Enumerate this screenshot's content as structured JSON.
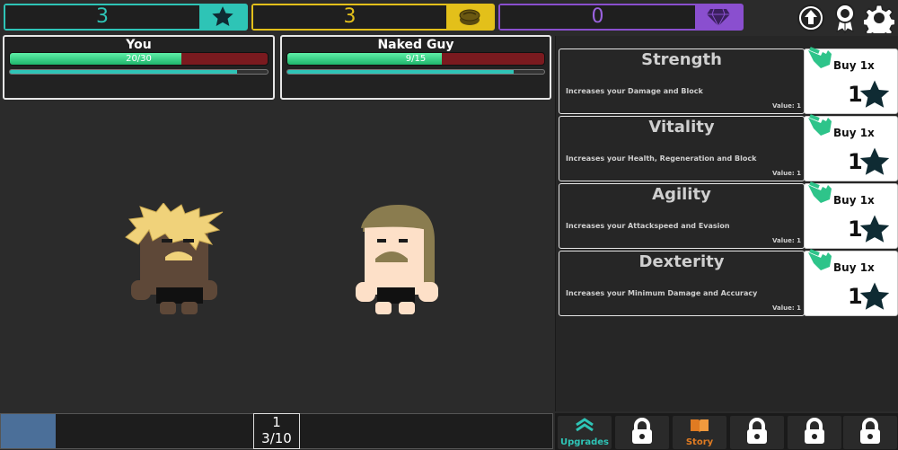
{
  "currencies": {
    "stars": {
      "value": "3",
      "icon": "star-icon",
      "color": "#2ec4b6"
    },
    "coins": {
      "value": "3",
      "icon": "coins-icon",
      "color": "#e3c01a"
    },
    "gems": {
      "value": "0",
      "icon": "diamond-icon",
      "color": "#8a4fcf"
    }
  },
  "top_icons": [
    "upgrade-arrow-icon",
    "ribbon-award-icon",
    "gear-icon"
  ],
  "player": {
    "name": "You",
    "hp_text": "20/30",
    "hp_fraction": 0.667,
    "speed_fraction": 0.88
  },
  "enemy": {
    "name": "Naked Guy",
    "hp_text": "9/15",
    "hp_fraction": 0.6,
    "speed_fraction": 0.88
  },
  "stats": [
    {
      "title": "Strength",
      "desc": "Increases your Damage and Block",
      "value": "Value: 1",
      "buy_label": "Buy 1x",
      "cost": "1"
    },
    {
      "title": "Vitality",
      "desc": "Increases your Health, Regeneration and Block",
      "value": "Value: 1",
      "buy_label": "Buy 1x",
      "cost": "1"
    },
    {
      "title": "Agility",
      "desc": "Increases your Attackspeed and Evasion",
      "value": "Value: 1",
      "buy_label": "Buy 1x",
      "cost": "1"
    },
    {
      "title": "Dexterity",
      "desc": "Increases your Minimum Damage and Accuracy",
      "value": "Value: 1",
      "buy_label": "Buy 1x",
      "cost": "1"
    }
  ],
  "stage": {
    "level": "1",
    "progress": "3/10",
    "progress_fraction": 0.1
  },
  "tabs": [
    {
      "label": "Upgrades",
      "icon": "upgrades-chevron-icon",
      "color": "#2ec4b6"
    },
    {
      "label": "",
      "icon": "lock-icon"
    },
    {
      "label": "Story",
      "icon": "book-icon",
      "color": "#e07b22"
    },
    {
      "label": "",
      "icon": "lock-icon"
    },
    {
      "label": "",
      "icon": "lock-icon"
    },
    {
      "label": "",
      "icon": "lock-icon"
    }
  ]
}
